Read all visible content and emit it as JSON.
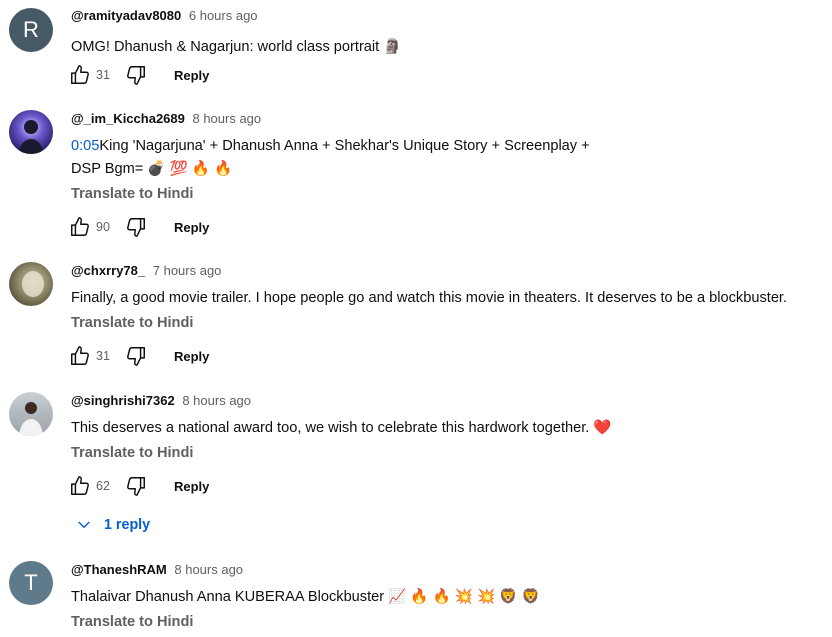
{
  "comments": [
    {
      "author": "@ramityadav8080",
      "time": "6 hours ago",
      "avatar_letter": "R",
      "avatar_color": "#455a64",
      "text": "OMG! Dhanush & Nagarjun: world class portrait 🗿",
      "likes": "31",
      "reply_label": "Reply"
    },
    {
      "author": "@_im_Kiccha2689",
      "time": "8 hours ago",
      "timestamp_link": "0:05",
      "text_line1": "King 'Nagarjuna' + Dhanush Anna + Shekhar's Unique Story + Screenplay +",
      "text_line2": "DSP Bgm= 💣 💯 🔥 🔥",
      "translate_label": "Translate to Hindi",
      "likes": "90",
      "reply_label": "Reply"
    },
    {
      "author": "@chxrry78_",
      "time": "7 hours ago",
      "text": "Finally, a good movie trailer. I hope people go and watch this movie in theaters. It deserves to be a blockbuster.",
      "translate_label": "Translate to Hindi",
      "likes": "31",
      "reply_label": "Reply"
    },
    {
      "author": "@singhrishi7362",
      "time": "8 hours ago",
      "text": "This deserves a national award too, we wish to celebrate this hardwork together. ❤️",
      "translate_label": "Translate to Hindi",
      "likes": "62",
      "reply_label": "Reply",
      "replies_label": "1 reply"
    },
    {
      "author": "@ThaneshRAM",
      "time": "8 hours ago",
      "avatar_letter": "T",
      "avatar_color": "#5f7a8a",
      "text": "Thalaivar Dhanush Anna KUBERAA Blockbuster 📈 🔥 🔥 💥 💥 🦁 🦁",
      "translate_label": "Translate to Hindi"
    }
  ],
  "colors": {
    "link_blue": "#065fd4",
    "secondary_text": "#606060",
    "primary_text": "#0f0f0f"
  },
  "icons": [
    "thumbs-up-icon",
    "thumbs-down-icon",
    "chevron-down-icon"
  ]
}
